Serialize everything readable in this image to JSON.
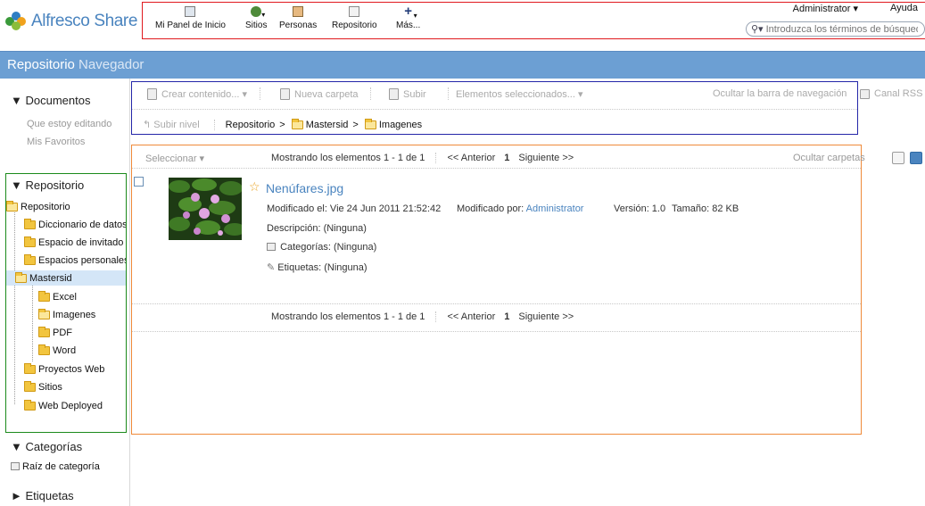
{
  "app": {
    "logo_text": "Alfresco Share",
    "brand_color": "#4a84bf",
    "title_color": "#6c9fd3"
  },
  "header": {
    "nav": [
      {
        "label": "Mi Panel de Inicio",
        "icon": "dashboard-icon"
      },
      {
        "label": "Sitios",
        "icon": "globe-icon"
      },
      {
        "label": "Personas",
        "icon": "people-icon"
      },
      {
        "label": "Repositorio",
        "icon": "repository-icon"
      },
      {
        "label": "Más...",
        "icon": "plus-icon"
      }
    ],
    "user_label": "Administrator ▾",
    "help_label": "Ayuda",
    "search_placeholder": "Introduzca los términos de búsqueda"
  },
  "page_title": {
    "main": "Repositorio",
    "sub": "Navegador"
  },
  "sidebar": {
    "documentos_heading": "▼ Documentos",
    "documentos_links": [
      "Que estoy editando",
      "Mis Favoritos"
    ],
    "repositorio_heading": "▼ Repositorio",
    "tree": [
      "Repositorio",
      "Diccionario de datos",
      "Espacio de invitado",
      "Espacios personales",
      "Mastersid",
      "Excel",
      "Imagenes",
      "PDF",
      "Word",
      "Proyectos Web",
      "Sitios",
      "Web Deployed"
    ],
    "categorias_heading": "▼ Categorías",
    "categorias_root": "Raíz de categoría",
    "etiquetas_heading": "► Etiquetas"
  },
  "toolbar": {
    "create_content": "Crear contenido... ▾",
    "new_folder": "Nueva carpeta",
    "upload": "Subir",
    "selected_items": "Elementos seleccionados... ▾",
    "hide_nav_bar": "Ocultar la barra de navegación",
    "rss": "Canal RSS",
    "up_level": "Subir nivel"
  },
  "breadcrumb": {
    "sep": ">",
    "items": [
      "Repositorio",
      "Mastersid",
      "Imagenes"
    ]
  },
  "list": {
    "select_label": "Seleccionar ▾",
    "showing": "Mostrando los elementos 1 - 1 de 1",
    "prev": "<< Anterior",
    "page": "1",
    "next": "Siguiente >>",
    "hide_folders": "Ocultar carpetas"
  },
  "item": {
    "name": "Nenúfares.jpg",
    "modified_on": "Modificado el: Vie 24 Jun 2011 21:52:42",
    "modified_by_label": "Modificado por:",
    "modified_by": "Administrator",
    "version": "Versión: 1.0",
    "size": "Tamaño: 82 KB",
    "description": "Descripción: (Ninguna)",
    "categories": "Categorías: (Ninguna)",
    "tags": "Etiquetas: (Ninguna)"
  }
}
